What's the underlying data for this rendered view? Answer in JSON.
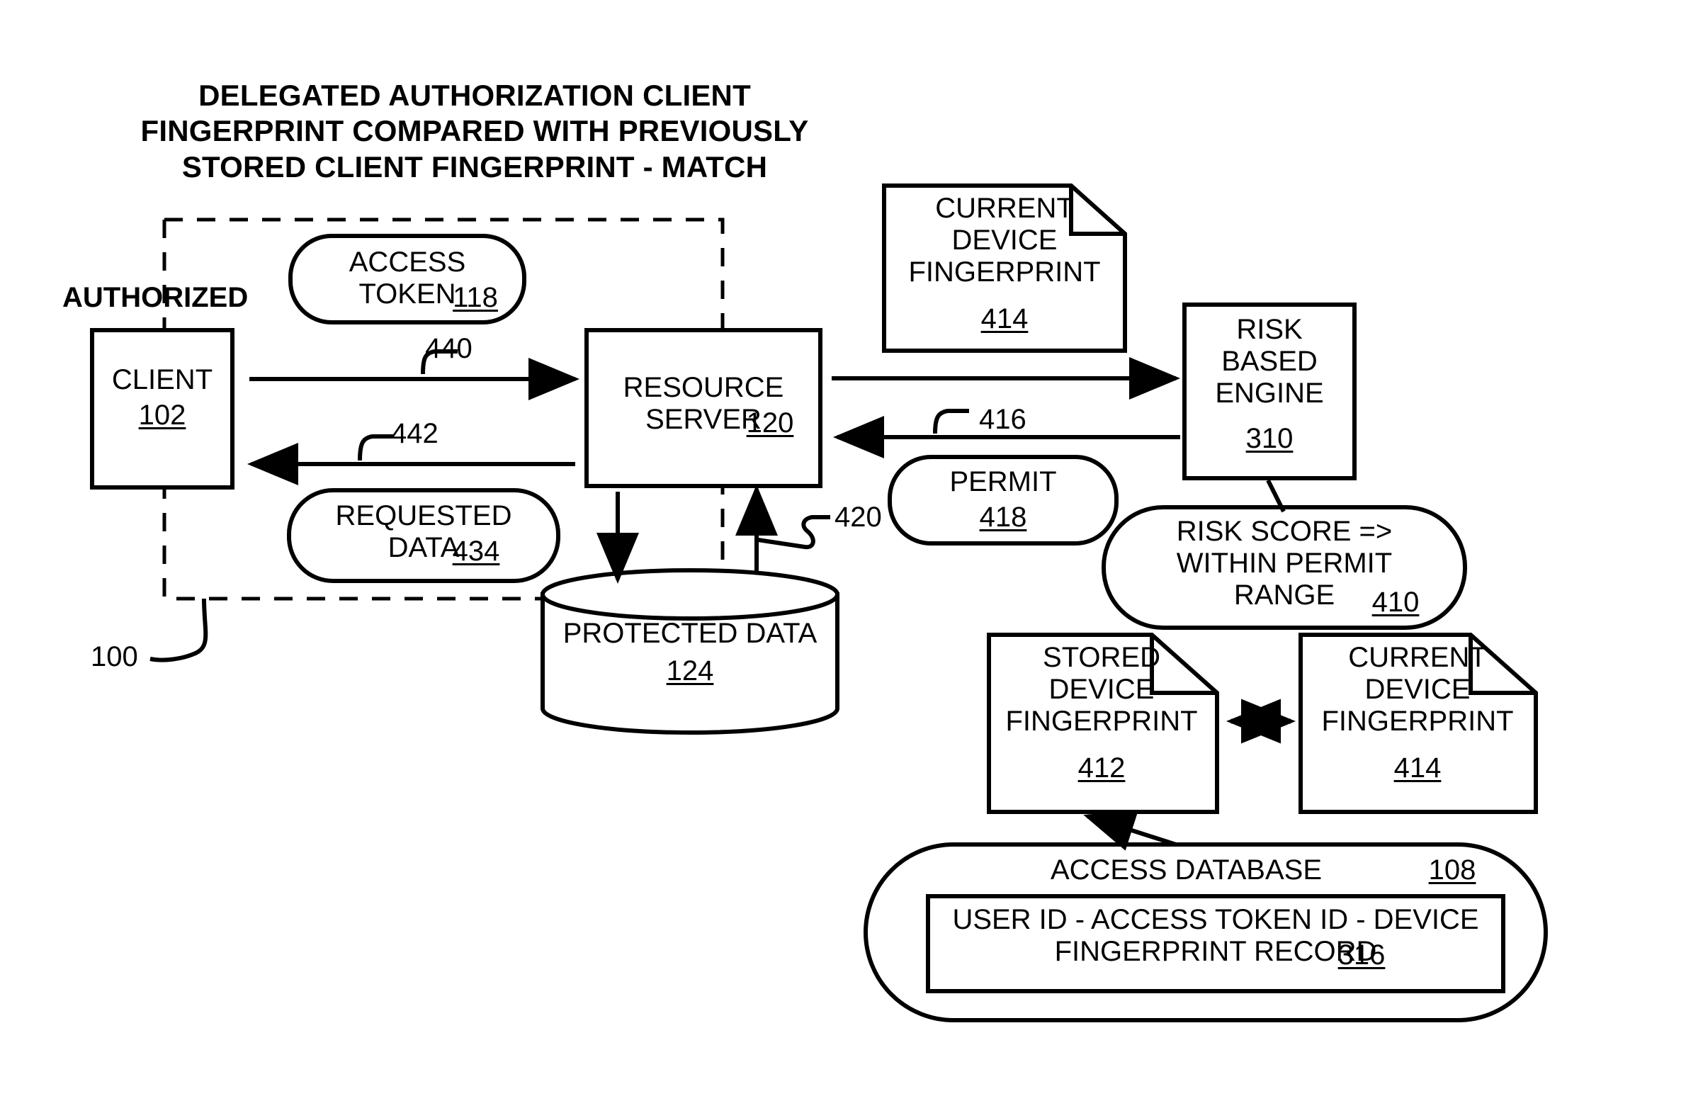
{
  "figure": {
    "title_lines": "DELEGATED AUTHORIZATION CLIENT\nFINGERPRINT COMPARED WITH PREVIOUSLY\nSTORED CLIENT FINGERPRINT - MATCH",
    "system_ref": "100",
    "boundary_label": "AUTHORIZED"
  },
  "nodes": {
    "client": {
      "name": "CLIENT",
      "ref": "102",
      "shape": "rectangle"
    },
    "access_token": {
      "name": "ACCESS\nTOKEN",
      "ref": "118",
      "shape": "rounded-capsule"
    },
    "resource_server": {
      "name": "RESOURCE\nSERVER",
      "ref": "120",
      "shape": "rectangle"
    },
    "requested_data": {
      "name": "REQUESTED\nDATA",
      "ref": "434",
      "shape": "rounded-capsule"
    },
    "protected_data": {
      "name": "PROTECTED DATA",
      "ref": "124",
      "shape": "cylinder"
    },
    "current_device_fingerprint_top": {
      "name": "CURRENT\nDEVICE\nFINGERPRINT",
      "ref": "414",
      "shape": "document"
    },
    "risk_based_engine": {
      "name": "RISK\nBASED\nENGINE",
      "ref": "310",
      "shape": "rectangle"
    },
    "permit": {
      "name": "PERMIT",
      "ref": "418",
      "shape": "rounded-capsule"
    },
    "risk_score": {
      "name": "RISK SCORE =>\nWITHIN PERMIT\nRANGE",
      "ref": "410",
      "shape": "rounded-capsule"
    },
    "stored_device_fingerprint": {
      "name": "STORED\nDEVICE\nFINGERPRINT",
      "ref": "412",
      "shape": "document"
    },
    "current_device_fingerprint_bottom": {
      "name": "CURRENT\nDEVICE\nFINGERPRINT",
      "ref": "414",
      "shape": "document"
    },
    "access_database": {
      "name": "ACCESS DATABASE",
      "ref": "108",
      "shape": "rounded-capsule"
    },
    "fingerprint_record": {
      "name": "USER ID - ACCESS TOKEN ID - DEVICE\nFINGERPRINT RECORD",
      "ref": "316",
      "shape": "rectangle"
    }
  },
  "connectors": [
    {
      "id": "client-to-resource-server",
      "ref": "440",
      "direction": "right"
    },
    {
      "id": "resource-server-to-client",
      "ref": "442",
      "direction": "left"
    },
    {
      "id": "resource-server-to-risk-engine",
      "ref": "",
      "direction": "right"
    },
    {
      "id": "risk-engine-to-resource-server",
      "ref": "416",
      "direction": "left"
    },
    {
      "id": "protected-data-to-resource-server",
      "ref": "420",
      "direction": "up"
    },
    {
      "id": "resource-server-to-protected-data",
      "ref": "",
      "direction": "down"
    },
    {
      "id": "stored-vs-current-fingerprint",
      "ref": "",
      "direction": "both"
    },
    {
      "id": "access-database-to-stored-fingerprint",
      "ref": "",
      "direction": "up-left"
    },
    {
      "id": "risk-engine-to-risk-score",
      "ref": "",
      "direction": "down-left"
    }
  ],
  "colors": {
    "stroke": "#000000",
    "background": "#ffffff"
  }
}
